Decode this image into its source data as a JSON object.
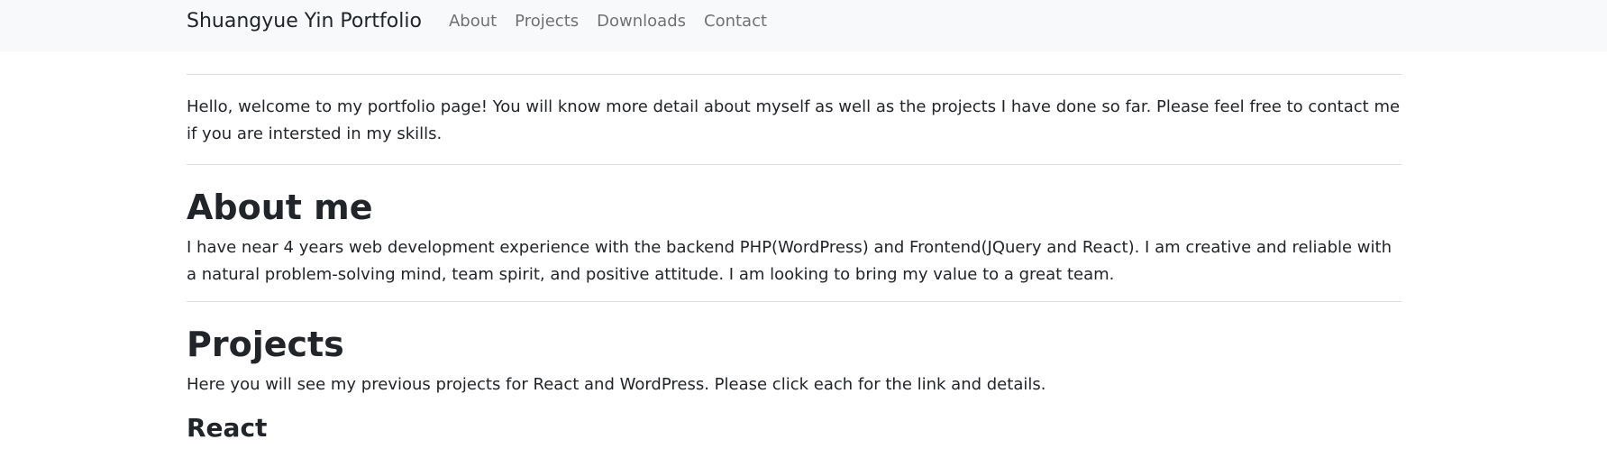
{
  "navbar": {
    "brand": "Shuangyue Yin Portfolio",
    "links": [
      {
        "label": "About"
      },
      {
        "label": "Projects"
      },
      {
        "label": "Downloads"
      },
      {
        "label": "Contact"
      }
    ]
  },
  "intro": {
    "text": "Hello, welcome to my portfolio page! You will know more detail about myself as well as the projects I have done so far. Please feel free to contact me if you are intersted in my skills."
  },
  "about": {
    "heading": "About me",
    "text": "I have near 4 years web development experience with the backend PHP(WordPress) and Frontend(JQuery and React). I am creative and reliable with a natural problem-solving mind, team spirit, and positive attitude. I am looking to bring my value to a great team."
  },
  "projects": {
    "heading": "Projects",
    "text": "Here you will see my previous projects for React and WordPress. Please click each for the link and details.",
    "subheading": "React"
  }
}
